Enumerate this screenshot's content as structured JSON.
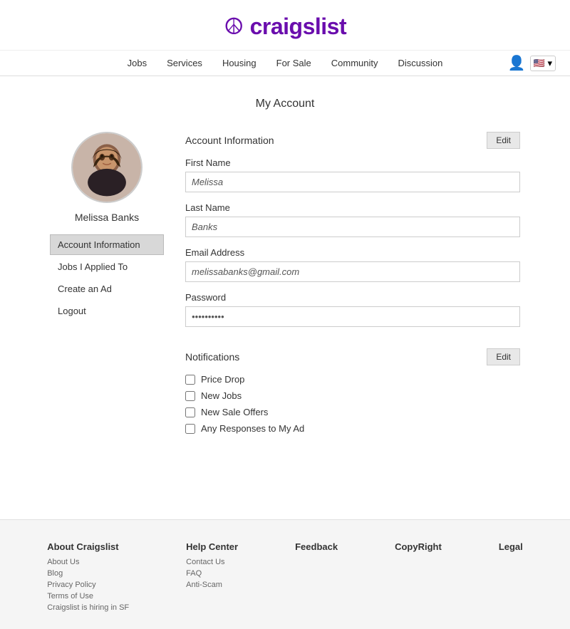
{
  "header": {
    "logo_text": "craigslist",
    "peace_symbol": "☮"
  },
  "nav": {
    "links": [
      {
        "label": "Jobs",
        "href": "#"
      },
      {
        "label": "Services",
        "href": "#"
      },
      {
        "label": "Housing",
        "href": "#"
      },
      {
        "label": "For Sale",
        "href": "#"
      },
      {
        "label": "Community",
        "href": "#"
      },
      {
        "label": "Discussion",
        "href": "#"
      }
    ],
    "flag_label": "🇺🇸 ▾"
  },
  "page": {
    "title": "My Account"
  },
  "sidebar": {
    "user_name": "Melissa Banks",
    "menu_items": [
      {
        "label": "Account Information",
        "active": true
      },
      {
        "label": "Jobs I Applied To",
        "active": false
      },
      {
        "label": "Create an Ad",
        "active": false
      },
      {
        "label": "Logout",
        "active": false
      }
    ]
  },
  "account_info": {
    "section_title": "Account Information",
    "edit_label": "Edit",
    "first_name_label": "First Name",
    "first_name_value": "Melissa",
    "last_name_label": "Last Name",
    "last_name_value": "Banks",
    "email_label": "Email Address",
    "email_value": "melissabanks@gmail.com",
    "password_label": "Password",
    "password_value": "••••••••••"
  },
  "notifications": {
    "section_title": "Notifications",
    "edit_label": "Edit",
    "items": [
      {
        "label": "Price Drop",
        "checked": false
      },
      {
        "label": "New Jobs",
        "checked": false
      },
      {
        "label": "New Sale Offers",
        "checked": false
      },
      {
        "label": "Any Responses to My Ad",
        "checked": false
      }
    ]
  },
  "footer": {
    "columns": [
      {
        "heading": "About Craigslist",
        "links": [
          {
            "label": "About Us",
            "href": "#"
          },
          {
            "label": "Blog",
            "href": "#"
          },
          {
            "label": "Privacy Policy",
            "href": "#"
          },
          {
            "label": "Terms of Use",
            "href": "#"
          },
          {
            "label": "Craigslist is hiring in SF",
            "href": "#"
          }
        ]
      },
      {
        "heading": "Help Center",
        "links": [
          {
            "label": "Contact Us",
            "href": "#"
          },
          {
            "label": "FAQ",
            "href": "#"
          },
          {
            "label": "Anti-Scam",
            "href": "#"
          }
        ]
      },
      {
        "heading": "Feedback",
        "links": []
      },
      {
        "heading": "CopyRight",
        "links": []
      },
      {
        "heading": "Legal",
        "links": []
      }
    ]
  }
}
